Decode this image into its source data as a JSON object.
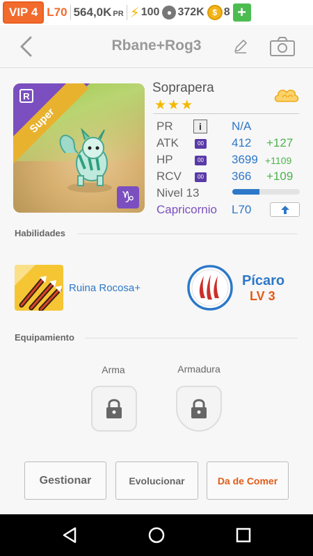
{
  "status": {
    "vip": "VIP 4",
    "level": "L70",
    "power": "564,0K",
    "power_unit": "PR",
    "energy": "100",
    "food": "372K",
    "coins": "8"
  },
  "header": {
    "title": "Rbane+Rog3"
  },
  "pet": {
    "rarity_badge": "R",
    "tier": "Super",
    "name": "Soprapera",
    "stars": "★★★",
    "element_icon": "cloud-icon",
    "zodiac_symbol": "♑",
    "stats": {
      "pr": {
        "label": "PR",
        "info": "i",
        "value": "N/A"
      },
      "atk": {
        "label": "ATK",
        "gem": "00",
        "value": "412",
        "bonus": "+127"
      },
      "hp": {
        "label": "HP",
        "gem": "00",
        "value": "3699",
        "bonus": "+1109"
      },
      "rcv": {
        "label": "RCV",
        "gem": "00",
        "value": "366",
        "bonus": "+109"
      },
      "level": {
        "label": "Nivel 13",
        "progress": 0.4
      },
      "zodiac": {
        "label": "Capricornio",
        "value": "L70"
      }
    }
  },
  "skills": {
    "section_title": "Habilidades",
    "skill_name": "Ruina Rocosa+",
    "class_name": "Pícaro",
    "class_level": "LV 3"
  },
  "equipment": {
    "section_title": "Equipamiento",
    "weapon_label": "Arma",
    "armor_label": "Armadura"
  },
  "actions": {
    "manage": "Gestionar",
    "evolve": "Evolucionar",
    "feed": "Da de Comer"
  },
  "colors": {
    "accent_orange": "#f26b2d",
    "accent_blue": "#2d78c8",
    "accent_green": "#4cb34c",
    "zodiac_purple": "#7b4fbf"
  }
}
